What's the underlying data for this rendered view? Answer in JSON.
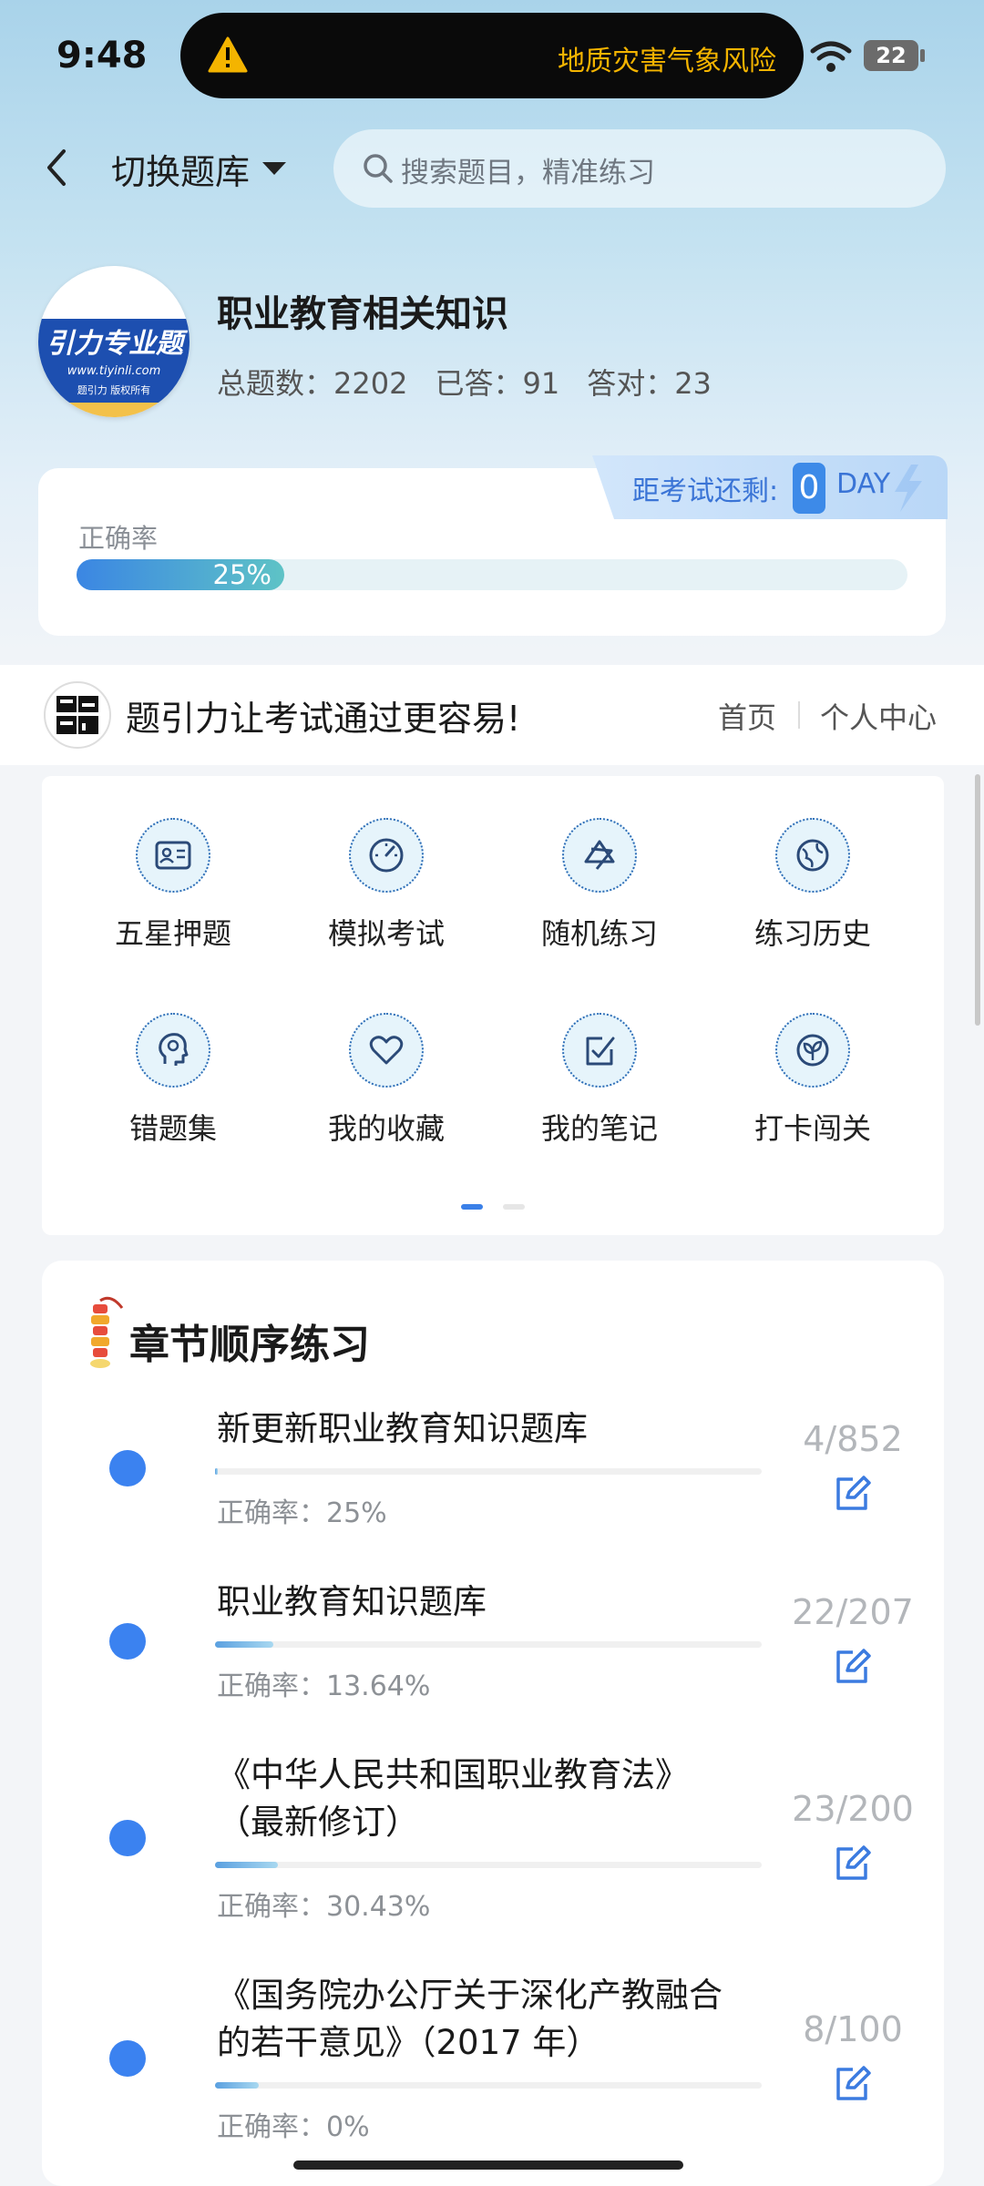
{
  "status_bar": {
    "time": "9:48",
    "alert": "地质灾害气象风险",
    "battery": "22"
  },
  "header": {
    "switch_label": "切换题库",
    "search_placeholder": "搜索题目，精准练习"
  },
  "bank": {
    "logo_text": "引力专业题",
    "logo_url": "www.tiyinli.com",
    "logo_sub": "题引力 版权所有",
    "title": "职业教育相关知识",
    "total": "总题数：2202",
    "answered": "已答：91",
    "correct": "答对：23"
  },
  "countdown": {
    "label": "距考试还剩:",
    "days": "0",
    "unit": "DAY"
  },
  "accuracy": {
    "label": "正确率",
    "percent_text": "25%",
    "value": 0.25
  },
  "brand": {
    "slogan": "题引力让考试通过更容易!",
    "nav_home": "首页",
    "nav_me": "个人中心"
  },
  "grid": {
    "items": [
      {
        "label": "五星押题",
        "icon": "id-card-icon"
      },
      {
        "label": "模拟考试",
        "icon": "gauge-icon"
      },
      {
        "label": "随机练习",
        "icon": "random-icon"
      },
      {
        "label": "练习历史",
        "icon": "globe-icon"
      },
      {
        "label": "错题集",
        "icon": "brain-head-icon"
      },
      {
        "label": "我的收藏",
        "icon": "heart-icon"
      },
      {
        "label": "我的笔记",
        "icon": "note-check-icon"
      },
      {
        "label": "打卡闯关",
        "icon": "sprout-icon"
      }
    ],
    "page": 1,
    "pages": 2
  },
  "chapters": {
    "title": "章节顺序练习",
    "items": [
      {
        "title1": "新更新职业教育知识题库",
        "title2": "",
        "accuracy": "正确率：25%",
        "count": "4/852",
        "progress": 0.005
      },
      {
        "title1": "职业教育知识题库",
        "title2": "",
        "accuracy": "正确率：13.64%",
        "count": "22/207",
        "progress": 0.106
      },
      {
        "title1": "《中华人民共和国职业教育法》",
        "title2": "（最新修订）",
        "accuracy": "正确率：30.43%",
        "count": "23/200",
        "progress": 0.115
      },
      {
        "title1": "《国务院办公厅关于深化产教融合",
        "title2": "的若干意见》（2017 年）",
        "accuracy": "正确率：0%",
        "count": "8/100",
        "progress": 0.08
      }
    ]
  },
  "colors": {
    "accent": "#3b82f0",
    "alert": "#f4b400",
    "progress_start": "#3b86e3",
    "progress_end": "#5ec3c6"
  }
}
